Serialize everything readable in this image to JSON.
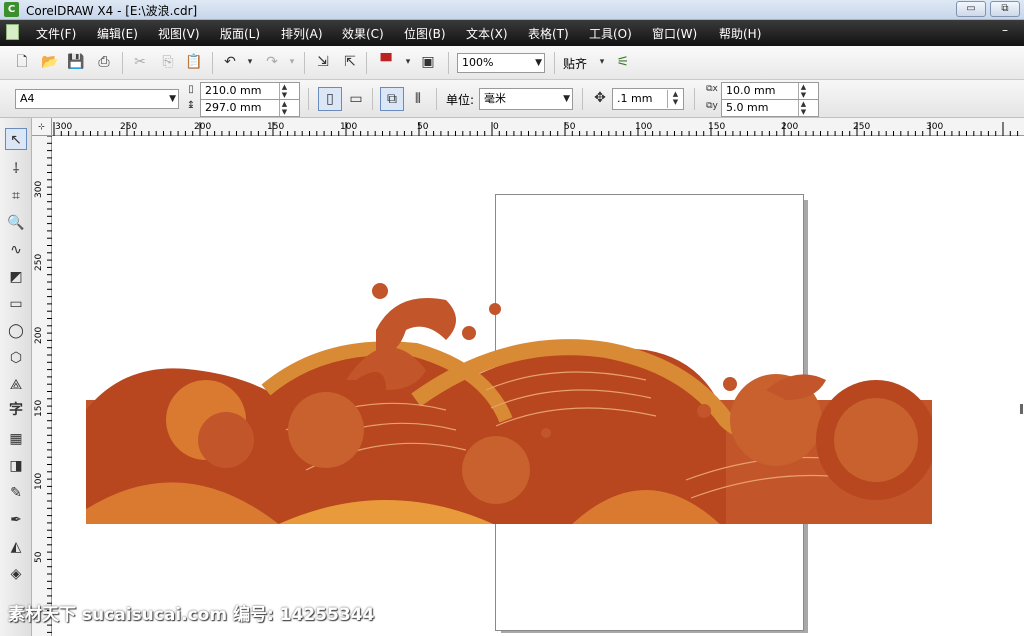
{
  "window": {
    "title": "CorelDRAW X4 - [E:\\波浪.cdr]",
    "minimize_label": "▭",
    "restore_label": "⧉"
  },
  "menu": [
    "文件(F)",
    "编辑(E)",
    "视图(V)",
    "版面(L)",
    "排列(A)",
    "效果(C)",
    "位图(B)",
    "文本(X)",
    "表格(T)",
    "工具(O)",
    "窗口(W)",
    "帮助(H)"
  ],
  "toolbar": {
    "zoom": "100%",
    "snap_label": "贴齐"
  },
  "property_bar": {
    "paper_size": "A4",
    "width": "210.0 mm",
    "height": "297.0 mm",
    "units_label": "单位:",
    "units_value": "毫米",
    "nudge": ".1 mm",
    "dup_x": "10.0 mm",
    "dup_y": "5.0 mm"
  },
  "ruler": {
    "h_ticks": [
      "300",
      "250",
      "200",
      "150",
      "100",
      "50",
      "0",
      "50",
      "100",
      "150",
      "200",
      "250",
      "300"
    ],
    "v_ticks": [
      "300",
      "250",
      "200",
      "150",
      "100",
      "50"
    ]
  },
  "tool_label_text": "字",
  "watermark": "素材天下 sucaisucai.com  编号: 14255344",
  "colors": {
    "wave_dark": "#c2552a",
    "wave_mid": "#d97a30",
    "wave_light": "#e99a3a",
    "wave_rust": "#b8461f",
    "menubar": "#1e1e1e"
  }
}
